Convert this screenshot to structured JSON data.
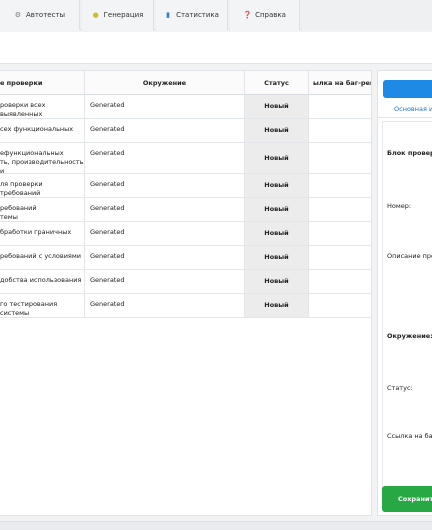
{
  "tabs": [
    {
      "label": "Автотесты",
      "icon": "gear-icon",
      "glyph": "⚙",
      "color": "#7a7a7a"
    },
    {
      "label": "Генерация",
      "icon": "lightbulb-icon",
      "glyph": "●",
      "color": "#c9c21f"
    },
    {
      "label": "Статистика",
      "icon": "bar-chart-icon",
      "glyph": "▮",
      "color": "#2a7fc9"
    },
    {
      "label": "Справка",
      "icon": "question-icon",
      "glyph": "❓",
      "color": "#d9342b"
    }
  ],
  "table": {
    "headers": [
      "е проверки",
      "Окружение",
      "Статус",
      "ылка на баг-репор"
    ],
    "rows": [
      {
        "name": "роверки всех выявленных",
        "env": "Generated",
        "status": "Новый"
      },
      {
        "name": "сех функциональных",
        "env": "Generated",
        "status": "Новый"
      },
      {
        "name": "ефункциональных\nть, производительность и",
        "env": "Generated",
        "status": "Новый"
      },
      {
        "name": "ля проверки требований",
        "env": "Generated",
        "status": "Новый"
      },
      {
        "name": "ребований\nтемы",
        "env": "Generated",
        "status": "Новый"
      },
      {
        "name": "бработки граничных",
        "env": "Generated",
        "status": "Новый"
      },
      {
        "name": "ребований с условиями",
        "env": "Generated",
        "status": "Новый"
      },
      {
        "name": "добства использования",
        "env": "Generated",
        "status": "Новый"
      },
      {
        "name": "го тестирования системы",
        "env": "Generated",
        "status": "Новый"
      }
    ]
  },
  "side": {
    "tab_label": "Основная ин",
    "block_label": "Блок проверок",
    "number_label": "Номер:",
    "description_label": "Описание пров",
    "env_label": "Окружение:",
    "status_label": "Статус:",
    "bug_link_label": "Ссылка на баг-р",
    "save_label": "Сохранить",
    "accent": "#1f8ae6",
    "save_color": "#28a745"
  }
}
